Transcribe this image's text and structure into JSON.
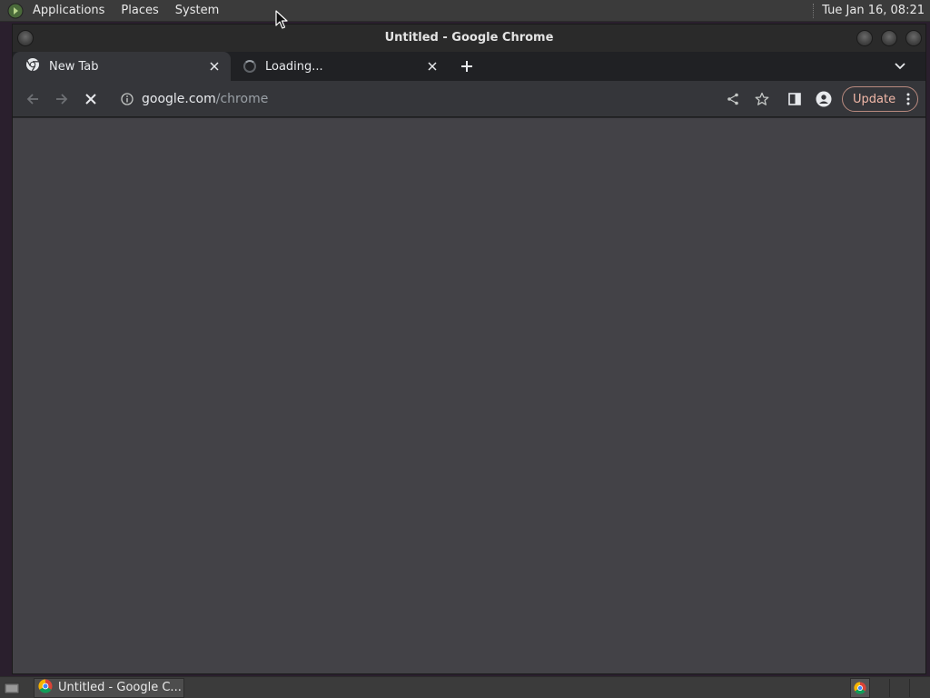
{
  "top_panel": {
    "menus": [
      "Applications",
      "Places",
      "System"
    ],
    "clock": "Tue Jan 16, 08:21"
  },
  "window": {
    "title": "Untitled - Google Chrome"
  },
  "tabs": [
    {
      "title": "New Tab",
      "icon": "chrome-icon",
      "active": true
    },
    {
      "title": "Loading...",
      "icon": "loading-spinner",
      "active": false
    }
  ],
  "toolbar": {
    "url_host": "google.com",
    "url_path": "/chrome",
    "update_label": "Update"
  },
  "taskbar": {
    "task_label": "Untitled - Google C..."
  },
  "colors": {
    "update_accent": "#f2b8a8",
    "content_bg": "#434247",
    "tab_active_bg": "#35363a"
  }
}
